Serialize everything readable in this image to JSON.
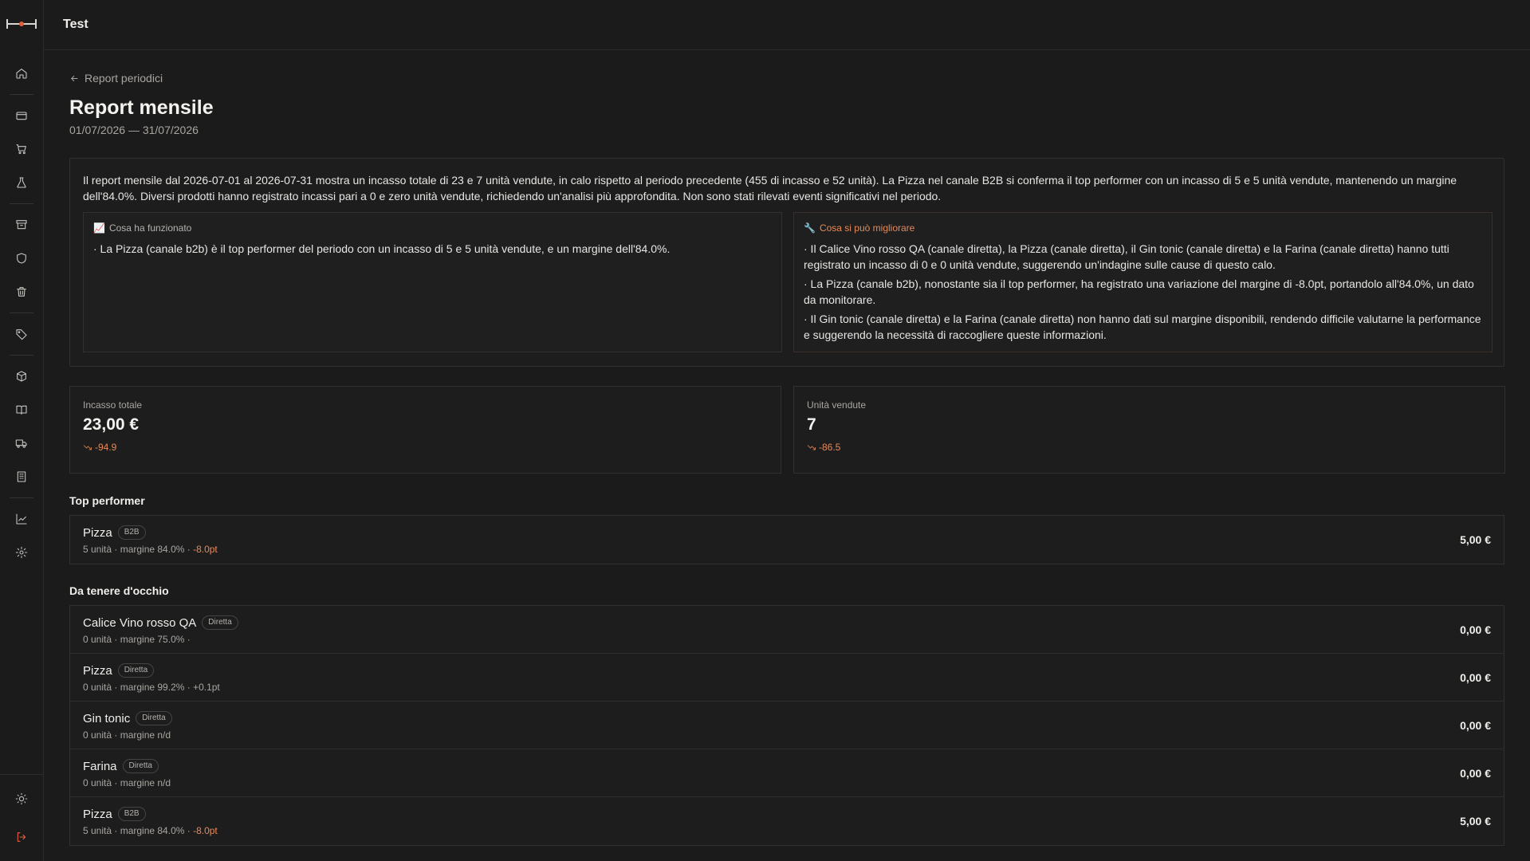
{
  "header": {
    "title": "Test"
  },
  "sidebar": {
    "icons": [
      "home-icon",
      "credit-card-icon",
      "cart-icon",
      "flask-icon",
      "archive-icon",
      "shield-icon",
      "trash-icon",
      "tag-icon",
      "box-icon",
      "book-icon",
      "truck-icon",
      "building-icon",
      "chart-icon",
      "settings-icon"
    ],
    "bottom_icons": [
      "sun-icon",
      "logout-icon"
    ],
    "accent": "#e5603a"
  },
  "page": {
    "back_label": "Report periodici",
    "title": "Report mensile",
    "date_range": "01/07/2026 — 31/07/2026"
  },
  "summary": {
    "text": "Il report mensile dal 2026-07-01 al 2026-07-31 mostra un incasso totale di 23 e 7 unità vendute, in calo rispetto al periodo precedente (455 di incasso e 52 unità). La Pizza nel canale B2B si conferma il top performer con un incasso di 5 e 5 unità vendute, mantenendo un margine dell'84.0%. Diversi prodotti hanno registrato incassi pari a 0 e zero unità vendute, richiedendo un'analisi più approfondita. Non sono stati rilevati eventi significativi nel periodo.",
    "worked": {
      "icon": "📈",
      "title": "Cosa ha funzionato",
      "items": [
        "· La Pizza (canale b2b) è il top performer del periodo con un incasso di 5 e 5 unità vendute, e un margine dell'84.0%."
      ]
    },
    "improve": {
      "icon": "🔧",
      "title": "Cosa si può migliorare",
      "items": [
        "· Il Calice Vino rosso QA (canale diretta), la Pizza (canale diretta), il Gin tonic (canale diretta) e la Farina (canale diretta) hanno tutti registrato un incasso di 0 e 0 unità vendute, suggerendo un'indagine sulle cause di questo calo.",
        "· La Pizza (canale b2b), nonostante sia il top performer, ha registrato una variazione del margine di -8.0pt, portandolo all'84.0%, un dato da monitorare.",
        "· Il Gin tonic (canale diretta) e la Farina (canale diretta) non hanno dati sul margine disponibili, rendendo difficile valutarne la performance e suggerendo la necessità di raccogliere queste informazioni."
      ]
    }
  },
  "kpis": [
    {
      "label": "Incasso totale",
      "value": "23,00 €",
      "delta": "-94.9"
    },
    {
      "label": "Unità vendute",
      "value": "7",
      "delta": "-86.5"
    }
  ],
  "top_performer": {
    "title": "Top performer",
    "rows": [
      {
        "name": "Pizza",
        "badge": "B2B",
        "meta": "5 unità · margine 84.0% · ",
        "delta": "-8.0pt",
        "amount": "5,00 €"
      }
    ]
  },
  "watch": {
    "title": "Da tenere d'occhio",
    "rows": [
      {
        "name": "Calice Vino rosso QA",
        "badge": "Diretta",
        "meta": "0 unità · margine 75.0% ·",
        "delta": "",
        "amount": "0,00 €"
      },
      {
        "name": "Pizza",
        "badge": "Diretta",
        "meta": "0 unità · margine 99.2% · +0.1pt",
        "delta": "",
        "amount": "0,00 €"
      },
      {
        "name": "Gin tonic",
        "badge": "Diretta",
        "meta": "0 unità · margine n/d",
        "delta": "",
        "amount": "0,00 €"
      },
      {
        "name": "Farina",
        "badge": "Diretta",
        "meta": "0 unità · margine n/d",
        "delta": "",
        "amount": "0,00 €"
      },
      {
        "name": "Pizza",
        "badge": "B2B",
        "meta": "5 unità · margine 84.0% · ",
        "delta": "-8.0pt",
        "amount": "5,00 €"
      }
    ]
  }
}
